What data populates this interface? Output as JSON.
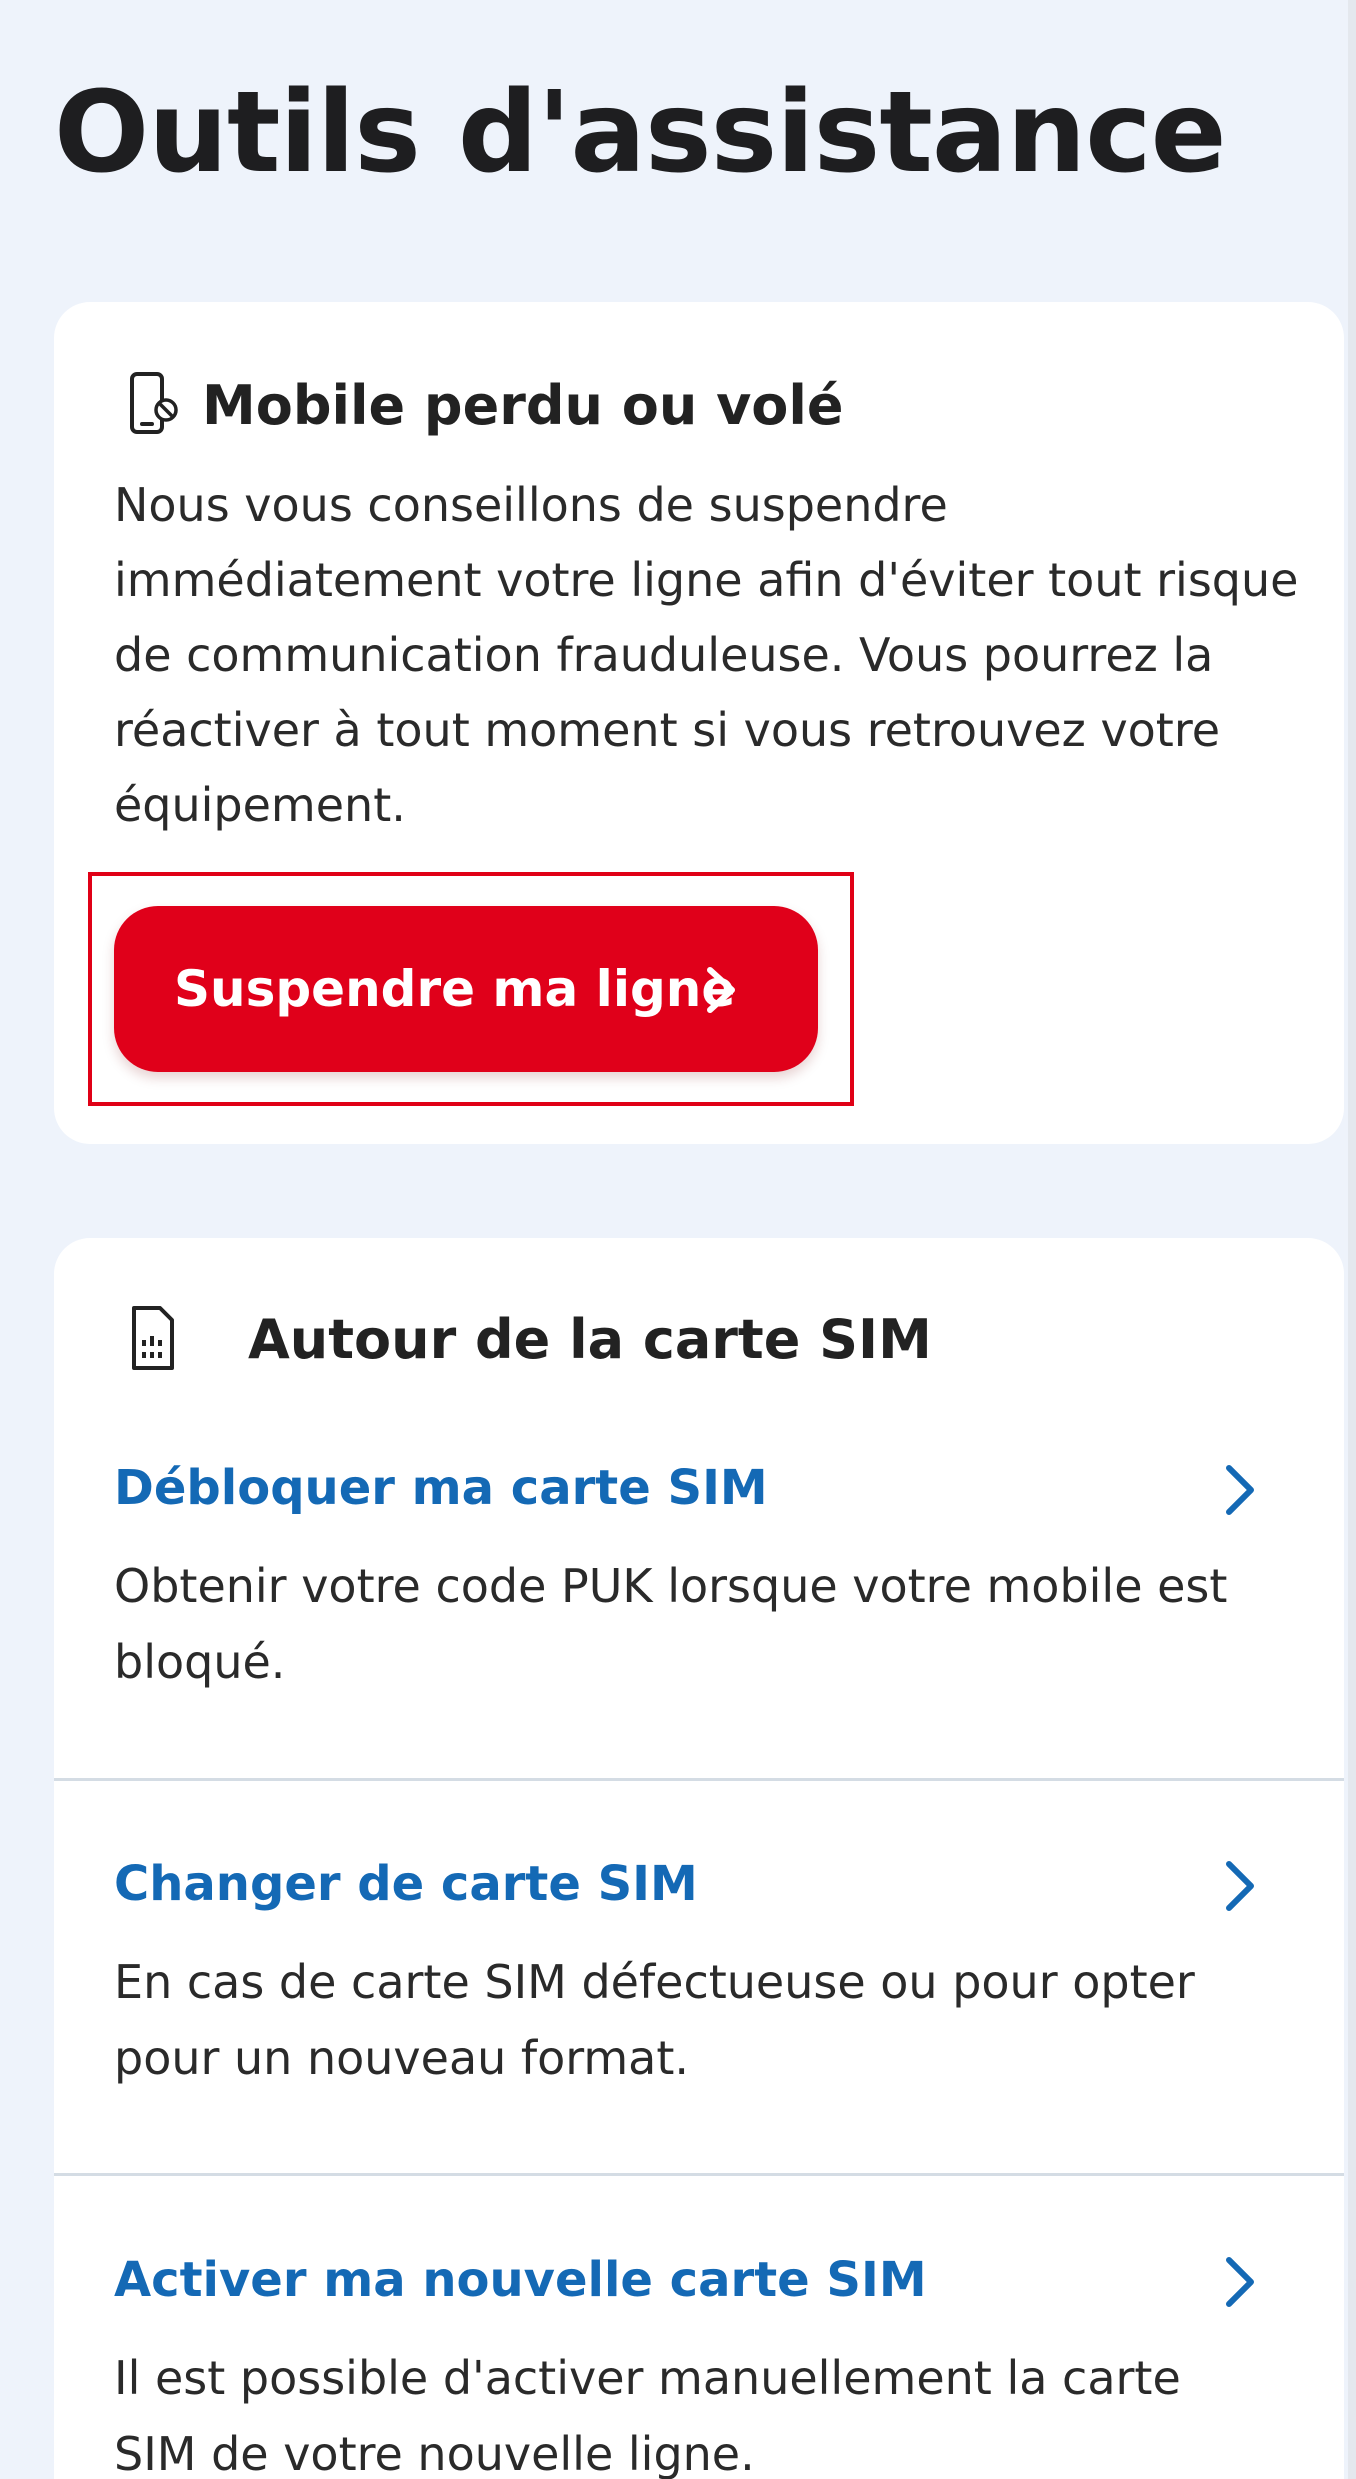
{
  "page": {
    "title": "Outils d'assistance"
  },
  "lost_card": {
    "title": "Mobile perdu ou volé",
    "icon": "phone-lock-icon",
    "text": "Nous vous conseillons de suspendre immédiatement votre ligne afin d'éviter tout risque de communication frauduleuse. Vous pourrez la réactiver à tout moment si vous retrouvez votre équipement.",
    "button_label": "Suspendre ma ligne",
    "button_color": "#e0001a"
  },
  "sim_card": {
    "title": "Autour de la carte SIM",
    "icon": "sim-card-icon",
    "link_color": "#1469b5",
    "items": [
      {
        "label": "Débloquer ma carte SIM",
        "description": "Obtenir votre code PUK lorsque votre mobile est bloqué."
      },
      {
        "label": "Changer de carte SIM",
        "description": "En cas de carte SIM défectueuse ou pour opter pour un nouveau format."
      },
      {
        "label": "Activer ma nouvelle carte SIM",
        "description": "Il est possible d'activer manuellement la carte SIM de votre nouvelle ligne."
      }
    ]
  }
}
